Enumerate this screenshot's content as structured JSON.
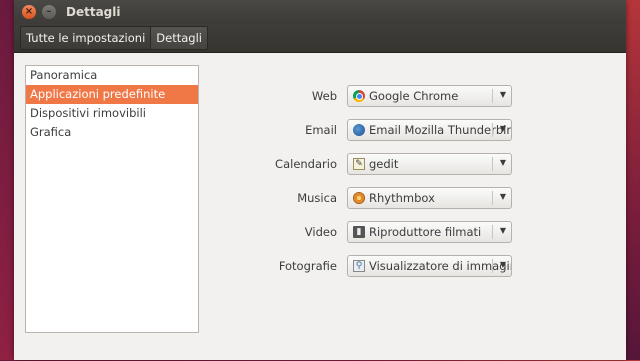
{
  "window": {
    "title": "Dettagli",
    "close_glyph": "×",
    "minimize_glyph": "–"
  },
  "breadcrumb": [
    "Tutte le impostazioni",
    "Dettagli"
  ],
  "sidebar": {
    "items": [
      {
        "label": "Panoramica",
        "selected": false
      },
      {
        "label": "Applicazioni predefinite",
        "selected": true
      },
      {
        "label": "Dispositivi rimovibili",
        "selected": false
      },
      {
        "label": "Grafica",
        "selected": false
      }
    ]
  },
  "defaults": [
    {
      "label": "Web",
      "value": "Google Chrome",
      "icon": "chrome-icon"
    },
    {
      "label": "Email",
      "value": "Email Mozilla Thunderbird",
      "icon": "thunderbird-icon"
    },
    {
      "label": "Calendario",
      "value": "gedit",
      "icon": "gedit-icon"
    },
    {
      "label": "Musica",
      "value": "Rhythmbox",
      "icon": "rhythmbox-icon"
    },
    {
      "label": "Video",
      "value": "Riproduttore filmati",
      "icon": "movie-player-icon"
    },
    {
      "label": "Fotografie",
      "value": "Visualizzatore di immagini",
      "icon": "image-viewer-icon"
    }
  ],
  "colors": {
    "selection": "#f07746",
    "titlebar": "#3c3b37",
    "close_button": "#e3602b"
  }
}
